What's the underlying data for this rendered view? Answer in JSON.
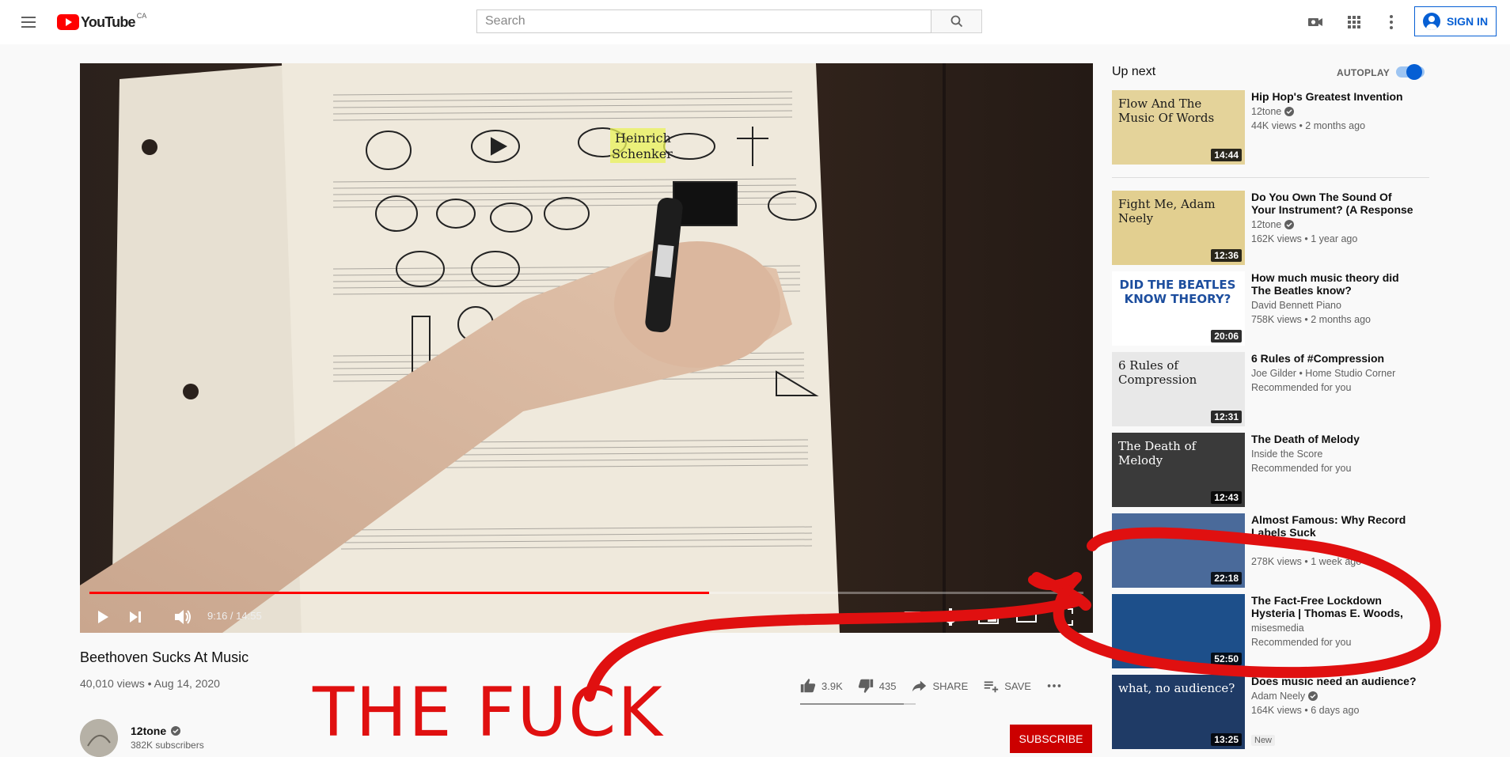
{
  "header": {
    "logo_text": "YouTube",
    "region": "CA",
    "search_placeholder": "Search",
    "signin_label": "SIGN IN"
  },
  "player": {
    "current_time": "9:16",
    "duration": "14:55",
    "time_display": "9:16 / 14:55",
    "progress": 0.6235
  },
  "video": {
    "title": "Beethoven Sucks At Music",
    "meta": "40,010 views • Aug 14, 2020",
    "likes": "3.9K",
    "dislikes": "435",
    "share_label": "SHARE",
    "save_label": "SAVE",
    "like_ratio": 0.9
  },
  "channel": {
    "name": "12tone",
    "subscribers": "382K subscribers",
    "subscribe_label": "Subscribe"
  },
  "sidebar": {
    "up_next_label": "Up next",
    "autoplay_label": "AUTOPLAY",
    "autoplay_on": true,
    "items": [
      {
        "title": "Hip Hop's Greatest Invention",
        "channel": "12tone",
        "verified": true,
        "meta": "44K views • 2 months ago",
        "duration": "14:44",
        "thumb_text": "Flow And The Music Of Words",
        "thumb_color": "#e4d39a"
      },
      {
        "title": "Do You Own The Sound Of Your Instrument? (A Response To…",
        "channel": "12tone",
        "verified": true,
        "meta": "162K views • 1 year ago",
        "duration": "12:36",
        "thumb_text": "Fight Me, Adam Neely",
        "thumb_color": "#e2cf90"
      },
      {
        "title": "How much music theory did The Beatles know?",
        "channel": "David Bennett Piano",
        "verified": false,
        "meta": "758K views • 2 months ago",
        "duration": "20:06",
        "thumb_text": "DID THE BEATLES KNOW THEORY?",
        "thumb_color": "#ffffff"
      },
      {
        "title": "6 Rules of #Compression",
        "channel": "Joe Gilder • Home Studio Corner",
        "verified": false,
        "meta": "Recommended for you",
        "duration": "12:31",
        "thumb_text": "6 Rules of Compression",
        "thumb_color": "#e8e8e8"
      },
      {
        "title": "The Death of Melody",
        "channel": "Inside the Score",
        "verified": false,
        "meta": "Recommended for you",
        "duration": "12:43",
        "thumb_text": "The Death of Melody",
        "thumb_color": "#3a3a3a"
      },
      {
        "title": "Almost Famous: Why Record Labels Suck",
        "channel": "",
        "verified": false,
        "meta": "278K views • 1 week ago",
        "duration": "22:18",
        "thumb_text": "",
        "thumb_color": "#4a6a9a"
      },
      {
        "title": "The Fact-Free Lockdown Hysteria | Thomas E. Woods, Jr.",
        "channel": "misesmedia",
        "verified": false,
        "meta": "Recommended for you",
        "duration": "52:50",
        "thumb_text": "",
        "thumb_color": "#1d4f8a"
      },
      {
        "title": "Does music need an audience?",
        "channel": "Adam Neely",
        "verified": true,
        "meta": "164K views • 6 days ago",
        "duration": "13:25",
        "thumb_text": "what, no audience?",
        "thumb_color": "#1f3b66",
        "badge": "New"
      }
    ]
  },
  "overlay": {
    "text": "THE FUCK",
    "color": "#e01010"
  }
}
